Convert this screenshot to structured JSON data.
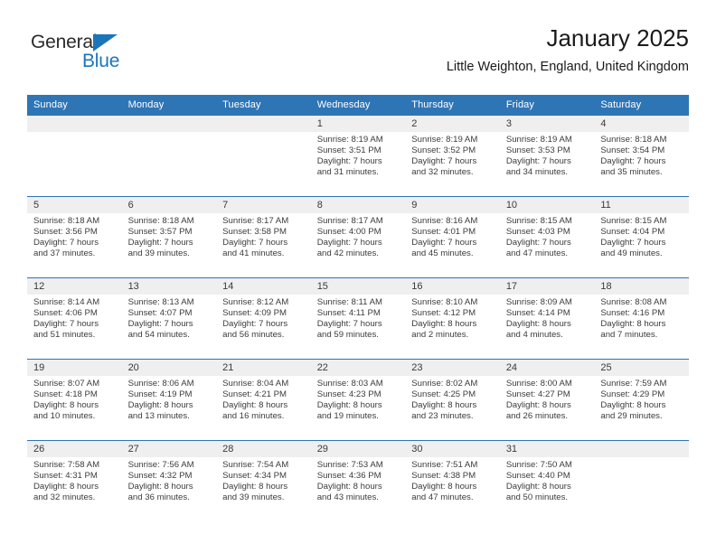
{
  "brand": {
    "name_part1": "General",
    "name_part2": "Blue",
    "accent_color": "#1b75bb",
    "triangle_icon": "triangle-icon"
  },
  "header": {
    "title": "January 2025",
    "subtitle": "Little Weighton, England, United Kingdom"
  },
  "calendar": {
    "header_bg": "#2e75b6",
    "daynum_bg": "#efefef",
    "weekdays": [
      "Sunday",
      "Monday",
      "Tuesday",
      "Wednesday",
      "Thursday",
      "Friday",
      "Saturday"
    ],
    "weeks": [
      [
        {
          "day": "",
          "empty": true,
          "sunrise": "",
          "sunset": "",
          "daylight_1": "",
          "daylight_2": ""
        },
        {
          "day": "",
          "empty": true,
          "sunrise": "",
          "sunset": "",
          "daylight_1": "",
          "daylight_2": ""
        },
        {
          "day": "",
          "empty": true,
          "sunrise": "",
          "sunset": "",
          "daylight_1": "",
          "daylight_2": ""
        },
        {
          "day": "1",
          "sunrise": "Sunrise: 8:19 AM",
          "sunset": "Sunset: 3:51 PM",
          "daylight_1": "Daylight: 7 hours",
          "daylight_2": "and 31 minutes."
        },
        {
          "day": "2",
          "sunrise": "Sunrise: 8:19 AM",
          "sunset": "Sunset: 3:52 PM",
          "daylight_1": "Daylight: 7 hours",
          "daylight_2": "and 32 minutes."
        },
        {
          "day": "3",
          "sunrise": "Sunrise: 8:19 AM",
          "sunset": "Sunset: 3:53 PM",
          "daylight_1": "Daylight: 7 hours",
          "daylight_2": "and 34 minutes."
        },
        {
          "day": "4",
          "sunrise": "Sunrise: 8:18 AM",
          "sunset": "Sunset: 3:54 PM",
          "daylight_1": "Daylight: 7 hours",
          "daylight_2": "and 35 minutes."
        }
      ],
      [
        {
          "day": "5",
          "sunrise": "Sunrise: 8:18 AM",
          "sunset": "Sunset: 3:56 PM",
          "daylight_1": "Daylight: 7 hours",
          "daylight_2": "and 37 minutes."
        },
        {
          "day": "6",
          "sunrise": "Sunrise: 8:18 AM",
          "sunset": "Sunset: 3:57 PM",
          "daylight_1": "Daylight: 7 hours",
          "daylight_2": "and 39 minutes."
        },
        {
          "day": "7",
          "sunrise": "Sunrise: 8:17 AM",
          "sunset": "Sunset: 3:58 PM",
          "daylight_1": "Daylight: 7 hours",
          "daylight_2": "and 41 minutes."
        },
        {
          "day": "8",
          "sunrise": "Sunrise: 8:17 AM",
          "sunset": "Sunset: 4:00 PM",
          "daylight_1": "Daylight: 7 hours",
          "daylight_2": "and 42 minutes."
        },
        {
          "day": "9",
          "sunrise": "Sunrise: 8:16 AM",
          "sunset": "Sunset: 4:01 PM",
          "daylight_1": "Daylight: 7 hours",
          "daylight_2": "and 45 minutes."
        },
        {
          "day": "10",
          "sunrise": "Sunrise: 8:15 AM",
          "sunset": "Sunset: 4:03 PM",
          "daylight_1": "Daylight: 7 hours",
          "daylight_2": "and 47 minutes."
        },
        {
          "day": "11",
          "sunrise": "Sunrise: 8:15 AM",
          "sunset": "Sunset: 4:04 PM",
          "daylight_1": "Daylight: 7 hours",
          "daylight_2": "and 49 minutes."
        }
      ],
      [
        {
          "day": "12",
          "sunrise": "Sunrise: 8:14 AM",
          "sunset": "Sunset: 4:06 PM",
          "daylight_1": "Daylight: 7 hours",
          "daylight_2": "and 51 minutes."
        },
        {
          "day": "13",
          "sunrise": "Sunrise: 8:13 AM",
          "sunset": "Sunset: 4:07 PM",
          "daylight_1": "Daylight: 7 hours",
          "daylight_2": "and 54 minutes."
        },
        {
          "day": "14",
          "sunrise": "Sunrise: 8:12 AM",
          "sunset": "Sunset: 4:09 PM",
          "daylight_1": "Daylight: 7 hours",
          "daylight_2": "and 56 minutes."
        },
        {
          "day": "15",
          "sunrise": "Sunrise: 8:11 AM",
          "sunset": "Sunset: 4:11 PM",
          "daylight_1": "Daylight: 7 hours",
          "daylight_2": "and 59 minutes."
        },
        {
          "day": "16",
          "sunrise": "Sunrise: 8:10 AM",
          "sunset": "Sunset: 4:12 PM",
          "daylight_1": "Daylight: 8 hours",
          "daylight_2": "and 2 minutes."
        },
        {
          "day": "17",
          "sunrise": "Sunrise: 8:09 AM",
          "sunset": "Sunset: 4:14 PM",
          "daylight_1": "Daylight: 8 hours",
          "daylight_2": "and 4 minutes."
        },
        {
          "day": "18",
          "sunrise": "Sunrise: 8:08 AM",
          "sunset": "Sunset: 4:16 PM",
          "daylight_1": "Daylight: 8 hours",
          "daylight_2": "and 7 minutes."
        }
      ],
      [
        {
          "day": "19",
          "sunrise": "Sunrise: 8:07 AM",
          "sunset": "Sunset: 4:18 PM",
          "daylight_1": "Daylight: 8 hours",
          "daylight_2": "and 10 minutes."
        },
        {
          "day": "20",
          "sunrise": "Sunrise: 8:06 AM",
          "sunset": "Sunset: 4:19 PM",
          "daylight_1": "Daylight: 8 hours",
          "daylight_2": "and 13 minutes."
        },
        {
          "day": "21",
          "sunrise": "Sunrise: 8:04 AM",
          "sunset": "Sunset: 4:21 PM",
          "daylight_1": "Daylight: 8 hours",
          "daylight_2": "and 16 minutes."
        },
        {
          "day": "22",
          "sunrise": "Sunrise: 8:03 AM",
          "sunset": "Sunset: 4:23 PM",
          "daylight_1": "Daylight: 8 hours",
          "daylight_2": "and 19 minutes."
        },
        {
          "day": "23",
          "sunrise": "Sunrise: 8:02 AM",
          "sunset": "Sunset: 4:25 PM",
          "daylight_1": "Daylight: 8 hours",
          "daylight_2": "and 23 minutes."
        },
        {
          "day": "24",
          "sunrise": "Sunrise: 8:00 AM",
          "sunset": "Sunset: 4:27 PM",
          "daylight_1": "Daylight: 8 hours",
          "daylight_2": "and 26 minutes."
        },
        {
          "day": "25",
          "sunrise": "Sunrise: 7:59 AM",
          "sunset": "Sunset: 4:29 PM",
          "daylight_1": "Daylight: 8 hours",
          "daylight_2": "and 29 minutes."
        }
      ],
      [
        {
          "day": "26",
          "sunrise": "Sunrise: 7:58 AM",
          "sunset": "Sunset: 4:31 PM",
          "daylight_1": "Daylight: 8 hours",
          "daylight_2": "and 32 minutes."
        },
        {
          "day": "27",
          "sunrise": "Sunrise: 7:56 AM",
          "sunset": "Sunset: 4:32 PM",
          "daylight_1": "Daylight: 8 hours",
          "daylight_2": "and 36 minutes."
        },
        {
          "day": "28",
          "sunrise": "Sunrise: 7:54 AM",
          "sunset": "Sunset: 4:34 PM",
          "daylight_1": "Daylight: 8 hours",
          "daylight_2": "and 39 minutes."
        },
        {
          "day": "29",
          "sunrise": "Sunrise: 7:53 AM",
          "sunset": "Sunset: 4:36 PM",
          "daylight_1": "Daylight: 8 hours",
          "daylight_2": "and 43 minutes."
        },
        {
          "day": "30",
          "sunrise": "Sunrise: 7:51 AM",
          "sunset": "Sunset: 4:38 PM",
          "daylight_1": "Daylight: 8 hours",
          "daylight_2": "and 47 minutes."
        },
        {
          "day": "31",
          "sunrise": "Sunrise: 7:50 AM",
          "sunset": "Sunset: 4:40 PM",
          "daylight_1": "Daylight: 8 hours",
          "daylight_2": "and 50 minutes."
        },
        {
          "day": "",
          "empty": true,
          "sunrise": "",
          "sunset": "",
          "daylight_1": "",
          "daylight_2": ""
        }
      ]
    ]
  }
}
